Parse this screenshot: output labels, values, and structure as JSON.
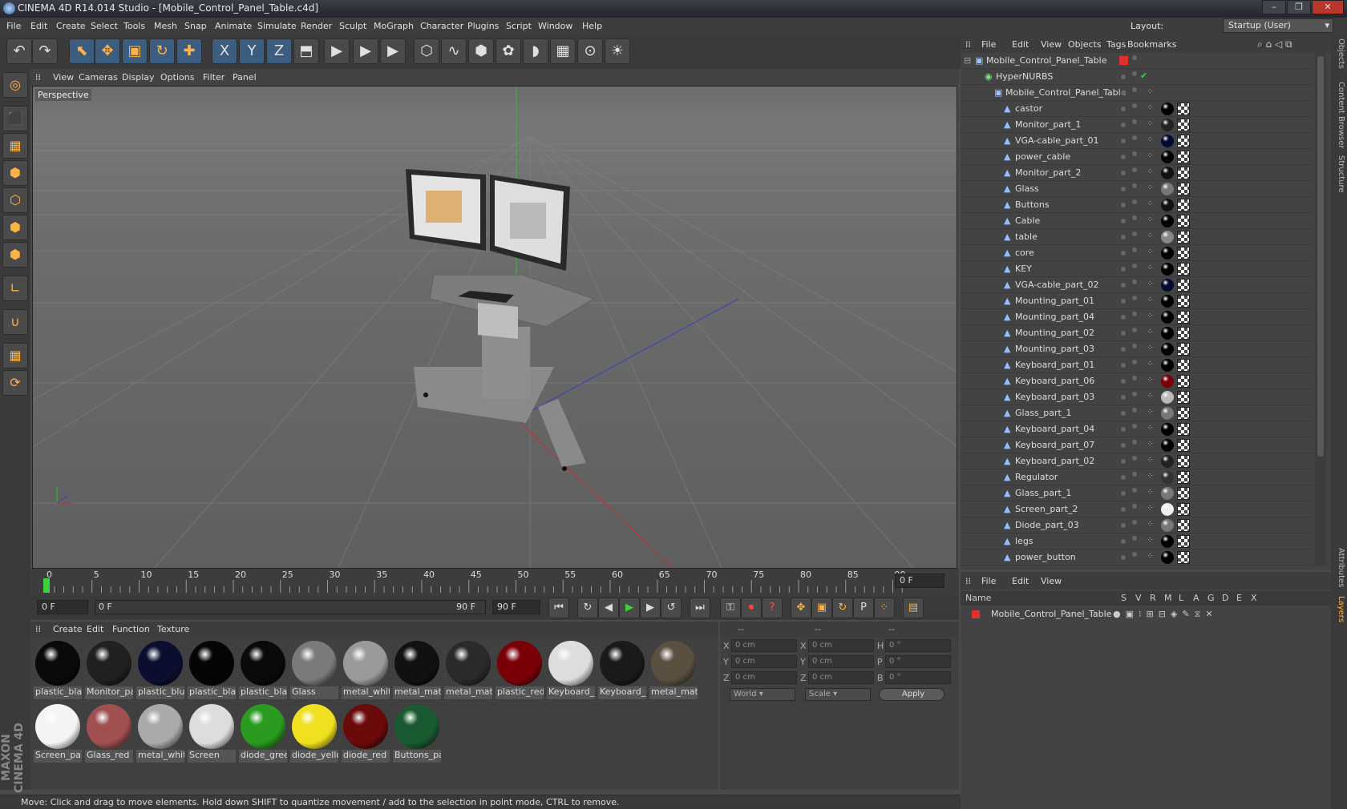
{
  "window": {
    "title": "CINEMA 4D R14.014 Studio - [Mobile_Control_Panel_Table.c4d]",
    "minimize": "–",
    "maximize": "❐",
    "close": "✕"
  },
  "menu": [
    "File",
    "Edit",
    "Create",
    "Select",
    "Tools",
    "Mesh",
    "Snap",
    "Animate",
    "Simulate",
    "Render",
    "Sculpt",
    "MoGraph",
    "Character",
    "Plugins",
    "Script",
    "Window",
    "Help"
  ],
  "layout": {
    "label": "Layout:",
    "value": "Startup (User)"
  },
  "toolbar": [
    "↶",
    "↷",
    "⬉",
    "✥",
    "▣",
    "↻",
    "✚",
    "X",
    "Y",
    "Z",
    "⬒",
    "▶",
    "▶",
    "▶",
    "⬡",
    "∿",
    "⬢",
    "✿",
    "◗",
    "▦",
    "⊙",
    "☀"
  ],
  "lefttools": [
    "◎",
    "⬛",
    "▦",
    "⬢",
    "⬡",
    "⬢",
    "⬢",
    "∟",
    "∪",
    "▦",
    "⟳"
  ],
  "viewport": {
    "menu": [
      "View",
      "Cameras",
      "Display",
      "Options",
      "Filter",
      "Panel"
    ],
    "label": "Perspective"
  },
  "timeline": {
    "ticks": [
      "0",
      "5",
      "10",
      "15",
      "20",
      "25",
      "30",
      "35",
      "40",
      "45",
      "50",
      "55",
      "60",
      "65",
      "70",
      "75",
      "80",
      "85",
      "90"
    ],
    "current": "0 F"
  },
  "transport": {
    "start": "0 F",
    "range_left": "0 F",
    "range_right": "90 F",
    "end": "90 F"
  },
  "materials": {
    "menu": [
      "Create",
      "Edit",
      "Function",
      "Texture"
    ],
    "items": [
      {
        "label": "plastic_blac",
        "color": "#0a0a0a"
      },
      {
        "label": "Monitor_pa",
        "color": "#202020"
      },
      {
        "label": "plastic_blu",
        "color": "#0a0f30"
      },
      {
        "label": "plastic_blac",
        "color": "#050505"
      },
      {
        "label": "plastic_blac",
        "color": "#0a0a0a"
      },
      {
        "label": "Glass",
        "color": "#7a7a7a"
      },
      {
        "label": "metal_whit",
        "color": "#9a9a9a"
      },
      {
        "label": "metal_mate",
        "color": "#111"
      },
      {
        "label": "metal_mate",
        "color": "#2a2a2a"
      },
      {
        "label": "plastic_red",
        "color": "#7a0008"
      },
      {
        "label": "Keyboard_p",
        "color": "#ddd"
      },
      {
        "label": "Keyboard_p",
        "color": "#1a1a1a"
      },
      {
        "label": "metal_mate",
        "color": "#5a5040"
      },
      {
        "label": "Screen_par",
        "color": "#f4f4f4"
      },
      {
        "label": "Glass_red",
        "color": "#a05050"
      },
      {
        "label": "metal_whit",
        "color": "#aaa"
      },
      {
        "label": "Screen",
        "color": "#ddd"
      },
      {
        "label": "diode_gree",
        "color": "#2a9a20"
      },
      {
        "label": "diode_yello",
        "color": "#f0e020"
      },
      {
        "label": "diode_red",
        "color": "#6a0a0a"
      },
      {
        "label": "Buttons_pa",
        "color": "#1a5a30"
      }
    ]
  },
  "coords": {
    "head": [
      "--",
      "--",
      "--"
    ],
    "rows": [
      {
        "a": "X",
        "av": "0 cm",
        "b": "X",
        "bv": "0 cm",
        "c": "H",
        "cv": "0 °"
      },
      {
        "a": "Y",
        "av": "0 cm",
        "b": "Y",
        "bv": "0 cm",
        "c": "P",
        "cv": "0 °"
      },
      {
        "a": "Z",
        "av": "0 cm",
        "b": "Z",
        "bv": "0 cm",
        "c": "B",
        "cv": "0 °"
      }
    ],
    "mode": "World",
    "scale": "Scale",
    "apply": "Apply"
  },
  "status": "Move: Click and drag to move elements. Hold down SHIFT to quantize movement / add to the selection in point mode, CTRL to remove.",
  "objects": {
    "menu": [
      "File",
      "Edit",
      "View",
      "Objects",
      "Tags",
      "Bookmarks"
    ],
    "root": "Mobile_Control_Panel_Table",
    "nurbs": "HyperNURBS",
    "group": "Mobile_Control_Panel_Table",
    "items": [
      {
        "name": "castor",
        "tag": "#000"
      },
      {
        "name": "Monitor_part_1",
        "tag": "#222"
      },
      {
        "name": "VGA-cable_part_01",
        "tag": "#050a30"
      },
      {
        "name": "power_cable",
        "tag": "#000"
      },
      {
        "name": "Monitor_part_2",
        "tag": "#111"
      },
      {
        "name": "Glass",
        "tag": "#777"
      },
      {
        "name": "Buttons",
        "tag": "#111"
      },
      {
        "name": "Cable",
        "tag": "#000"
      },
      {
        "name": "table",
        "tag": "#888"
      },
      {
        "name": "core",
        "tag": "#000"
      },
      {
        "name": "KEY",
        "tag": "#000"
      },
      {
        "name": "VGA-cable_part_02",
        "tag": "#050a30"
      },
      {
        "name": "Mounting_part_01",
        "tag": "#000"
      },
      {
        "name": "Mounting_part_04",
        "tag": "#000"
      },
      {
        "name": "Mounting_part_02",
        "tag": "#000"
      },
      {
        "name": "Mounting_part_03",
        "tag": "#000"
      },
      {
        "name": "Keyboard_part_01",
        "tag": "#000"
      },
      {
        "name": "Keyboard_part_06",
        "tag": "#7a0008"
      },
      {
        "name": "Keyboard_part_03",
        "tag": "#bbb"
      },
      {
        "name": "Glass_part_1",
        "tag": "#777"
      },
      {
        "name": "Keyboard_part_04",
        "tag": "#000"
      },
      {
        "name": "Keyboard_part_07",
        "tag": "#000"
      },
      {
        "name": "Keyboard_part_02",
        "tag": "#222"
      },
      {
        "name": "Regulator",
        "tag": "#333"
      },
      {
        "name": "Glass_part_1",
        "tag": "#777"
      },
      {
        "name": "Screen_part_2",
        "tag": "#eee"
      },
      {
        "name": "Diode_part_03",
        "tag": "#777"
      },
      {
        "name": "legs",
        "tag": "#000"
      },
      {
        "name": "power_button",
        "tag": "#000"
      }
    ]
  },
  "attributes": {
    "menu": [
      "File",
      "Edit",
      "View"
    ],
    "columns": [
      "Name",
      "S",
      "V",
      "R",
      "M",
      "L",
      "A",
      "G",
      "D",
      "E",
      "X"
    ],
    "row": "Mobile_Control_Panel_Table"
  },
  "sidetabs": [
    "Objects",
    "Content Browser",
    "Structure",
    "Attributes",
    "Layers"
  ],
  "branding": "MAXON CINEMA 4D"
}
